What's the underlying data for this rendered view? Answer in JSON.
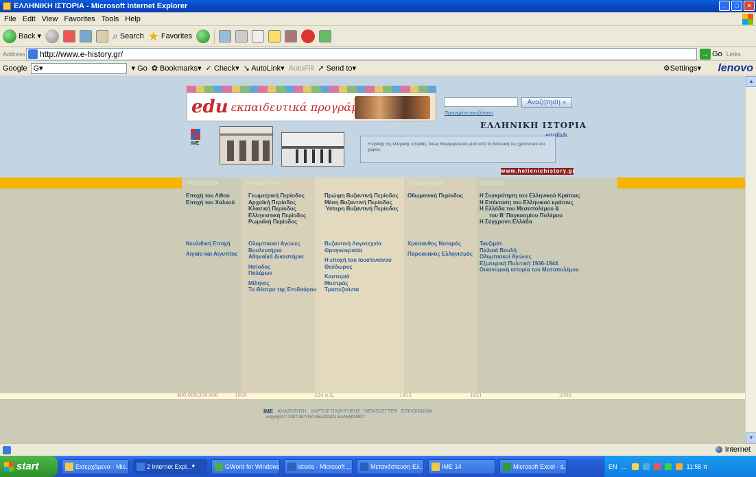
{
  "window": {
    "title": "ΕΛΛΗΝΙΚΗ ΙΣΤΟΡΙΑ - Microsoft Internet Explorer"
  },
  "menu": [
    "File",
    "Edit",
    "View",
    "Favorites",
    "Tools",
    "Help"
  ],
  "toolbar": {
    "back": "Back",
    "search": "Search",
    "favorites": "Favorites"
  },
  "address": {
    "label": "Address",
    "url": "http://www.e-history.gr/",
    "go": "Go",
    "links": "Links"
  },
  "googlebar": {
    "brand": "Google",
    "go": "Go",
    "bookmarks": "Bookmarks",
    "check": "Check",
    "autolink": "AutoLink",
    "autofill": "AutoFill",
    "sendto": "Send to",
    "settings": "Settings",
    "oem": "lenovo"
  },
  "site": {
    "banner_logo": "edu",
    "banner_text": "εκπαιδευτικά προγράμματα",
    "search_button": "Αναζήτηση »",
    "advanced_search": "Προηγμένη αναζήτηση",
    "title": "ΕΛΛΗΝΙΚΗ ΙΣΤΟΡΙΑ",
    "english": "english",
    "ime_logo": "IME",
    "description": "Η εξέλιξη της ελληνικής ιστορίας, όπως διαμορφώνεται μέσα από τη διαπλοκή του χρόνου και του χώρου.",
    "url_strip": "www.hellenichistory.gr"
  },
  "periods": [
    {
      "head": "ΠΡΟΪΣΤΟΡΙΑ",
      "groups": [
        [
          "Εποχή του Λίθου",
          "Εποχή του Χαλκού"
        ],
        [
          "Νεολιθική Εποχή",
          "Αιγαίο και Αίγυπτος"
        ]
      ]
    },
    {
      "head": "ΑΡΧΑΙΟΤΗΤΑ",
      "groups": [
        [
          "Γεωμετρική Περίοδος",
          "Αρχαϊκή Περίοδος",
          "Κλασική Περίοδος",
          "Ελληνιστική Περίοδος",
          "Ρωμαϊκή Περίοδος"
        ],
        [
          "Ολυμπιακοί Αγώνες",
          "Βουλευτήρια",
          "Αθηναϊκά Δικαστήρια",
          "Ησίοδος",
          "Πολέμων",
          "Μίλητος",
          "Το Θέατρο της Επιδαύρου"
        ]
      ]
    },
    {
      "head": "ΒΥΖΑΝΤΙΟ",
      "groups": [
        [
          "Πρώιμη Βυζαντινή Περίοδος",
          "Μέση Βυζαντινή Περίοδος",
          "Ύστερη Βυζαντινή Περίοδος"
        ],
        [
          "Βυζαντινή Λογοτεχνία",
          "Φραγκοκρατία",
          "Η εποχή του Ιουστινιανού",
          "Θεόδωρος",
          "Καστοριά",
          "Μυστράς",
          "Τραπεζούντα"
        ]
      ]
    },
    {
      "head": "ΟΘΩΜΑΝΙΚΑ",
      "groups": [
        [
          "Οθωμανική Περίοδος"
        ],
        [
          "Χρύσανθος Νοταράς",
          "Παροικιακός Ελληνισμός"
        ]
      ]
    },
    {
      "head": "ΝΕΟΤΕΡΑ",
      "groups": [
        [
          "Η Συγκρότηση του Ελληνικού Κράτους",
          "Η Επέκταση του Ελληνικού κράτους",
          "Η Ελλάδα του Μεσοπολέμου &",
          "του Β' Παγκοσμίου Πολέμου",
          "Η Σύγχρονη Ελλάδα"
        ],
        [
          "Τανζιμάτ",
          "Παλαιά Βουλή",
          "Ολυμπιακοί Αγώνες",
          "Εξωτερική Πολιτική 1936-1944",
          "Οικονομική ιστορία του Μεσοπολέμου"
        ]
      ]
    }
  ],
  "timeline": [
    "400.000/350.000",
    "1050",
    "324 π.Χ.",
    "1453",
    "1821",
    "2000"
  ],
  "footer": {
    "links": [
      "IME",
      "ΑΝΑΖΗΤΗΣΗ",
      "ΧΑΡΤΗΣ ΠΛΟΗΓΗΣΗΣ",
      "NEWSLETTER",
      "ΕΠΙΚΟΙΝΩΝΙΑ"
    ],
    "copyright": "copyright © 2007 ΙΔΡΥΜΑ ΜΕΙΖΟΝΟΣ ΕΛΛΗΝΙΣΜΟΥ"
  },
  "status": {
    "zone": "Internet"
  },
  "taskbar": {
    "start": "start",
    "tasks": [
      "Εισερχόμενα - Mic...",
      "2 Internet Expl...",
      "GWord for Windows",
      "istoria - Microsoft ...",
      "Μετανάστευση Ελ...",
      "IME 14",
      "Microsoft Excel - s..."
    ],
    "lang": "EN",
    "clock": "11:55 π"
  }
}
